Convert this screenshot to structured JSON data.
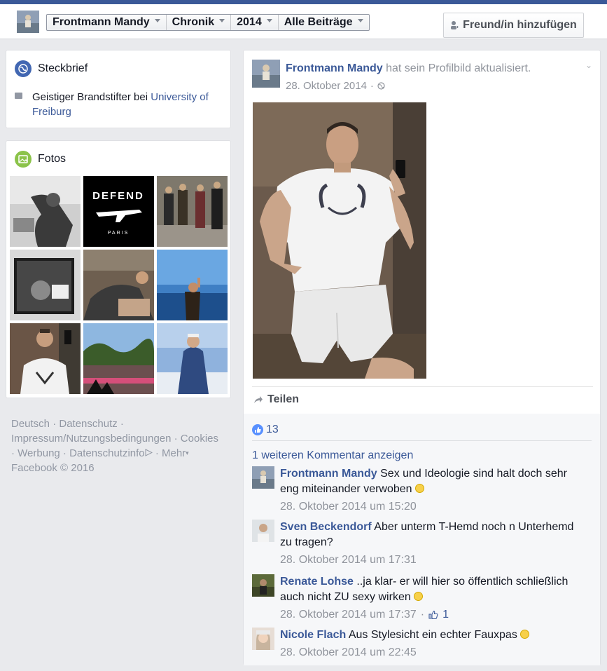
{
  "header": {
    "crumbs": [
      "Frontmann Mandy",
      "Chronik",
      "2014",
      "Alle Beiträge"
    ],
    "friend_button": "Freund/in hinzufügen"
  },
  "steckbrief": {
    "title": "Steckbrief",
    "work_prefix": "Geistiger Brandstifter bei ",
    "work_link": "University of Freiburg"
  },
  "fotos": {
    "title": "Fotos",
    "photo3_text": "DEFEND",
    "photo3_sub": "PARIS"
  },
  "footer": {
    "line1": "Deutsch · Datenschutz ·",
    "line2": "Impressum/Nutzungsbedingungen · Cookies",
    "line3a": "· Werbung · Datenschutzinfo",
    "line3b": " · Mehr",
    "line4": "Facebook © 2016"
  },
  "post": {
    "author": "Frontmann Mandy",
    "action": " hat sein Profilbild aktualisiert.",
    "date": "28. Oktober 2014",
    "sep": " · ",
    "share_label": "Teilen",
    "like_count": "13",
    "more_comments": "1 weiteren Kommentar anzeigen"
  },
  "comments": [
    {
      "name": "Frontmann Mandy",
      "text": " Sex und Ideologie sind halt doch sehr eng miteinander verwoben",
      "time": "28. Oktober 2014 um 15:20",
      "smile": true,
      "likes": ""
    },
    {
      "name": "Sven Beckendorf",
      "text": " Aber unterm T-Hemd noch n Unterhemd zu tragen?",
      "time": "28. Oktober 2014 um 17:31",
      "smile": false,
      "likes": ""
    },
    {
      "name": "Renate Lohse",
      "text": " ..ja klar- er will hier so öffentlich schließlich auch nicht ZU sexy wirken",
      "time": "28. Oktober 2014 um 17:37",
      "smile": true,
      "likes": "1"
    },
    {
      "name": "Nicole Flach",
      "text": " Aus Stylesicht ein echter Fauxpas",
      "time": "28. Oktober 2014 um 22:45",
      "smile": true,
      "likes": ""
    }
  ],
  "colors": {
    "brand": "#3b5998",
    "page_bg": "#e9eaed",
    "muted": "#90949c"
  }
}
